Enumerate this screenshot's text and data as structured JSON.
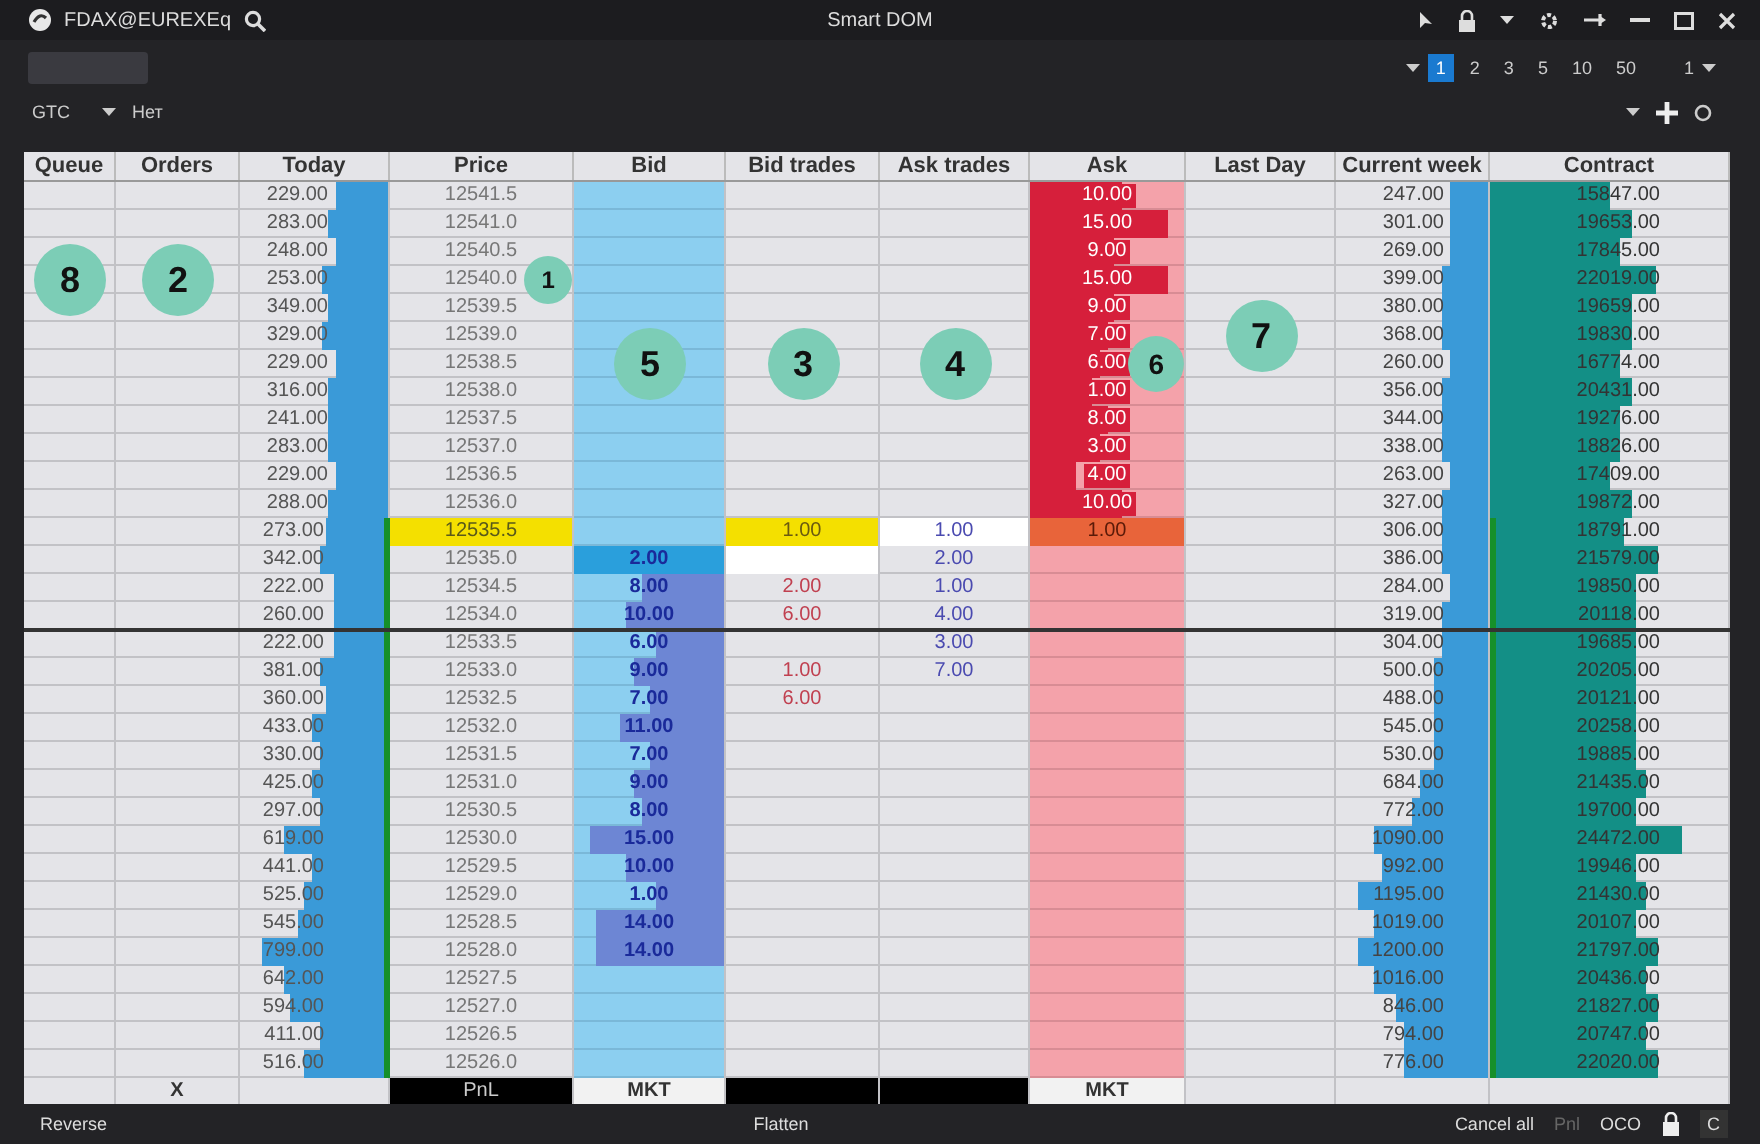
{
  "window": {
    "symbol": "FDAX@EUREXEq",
    "title": "Smart DOM"
  },
  "quantities": [
    {
      "label": "1",
      "selected": true
    },
    {
      "label": "2",
      "selected": false
    },
    {
      "label": "3",
      "selected": false
    },
    {
      "label": "5",
      "selected": false
    },
    {
      "label": "10",
      "selected": false
    },
    {
      "label": "50",
      "selected": false
    }
  ],
  "multiplier": "1",
  "order_bar": {
    "duration": "GTC",
    "option": "Нет"
  },
  "columns": [
    {
      "label": "Queue",
      "callout": "8"
    },
    {
      "label": "Orders",
      "callout": "2"
    },
    {
      "label": "Today"
    },
    {
      "label": "Price",
      "callout": "1"
    },
    {
      "label": "Bid",
      "callout": "5"
    },
    {
      "label": "Bid trades",
      "callout": "3"
    },
    {
      "label": "Ask trades",
      "callout": "4"
    },
    {
      "label": "Ask",
      "callout": "6"
    },
    {
      "label": "Last Day",
      "callout": "7"
    },
    {
      "label": "Current week"
    },
    {
      "label": "Contract"
    }
  ],
  "rows": [
    {
      "price": "12541.5",
      "today": {
        "value": "229.00",
        "level": 0.35
      },
      "ask": {
        "value": "10.00",
        "level": 0.6
      },
      "current_week": {
        "value": "247.00",
        "level": 0.25
      },
      "contract": {
        "value": "15847.00",
        "level": 0.5
      },
      "last_trade": false,
      "best_bid": false,
      "in_range": false
    },
    {
      "price": "12541.0",
      "today": {
        "value": "283.00",
        "level": 0.4
      },
      "ask": {
        "value": "15.00",
        "level": 0.9
      },
      "current_week": {
        "value": "301.00",
        "level": 0.25
      },
      "contract": {
        "value": "19653.00",
        "level": 0.6
      },
      "last_trade": false,
      "best_bid": false,
      "in_range": false
    },
    {
      "price": "12540.5",
      "today": {
        "value": "248.00",
        "level": 0.35
      },
      "ask": {
        "value": "9.00",
        "level": 0.55
      },
      "current_week": {
        "value": "269.00",
        "level": 0.25
      },
      "contract": {
        "value": "17845.00",
        "level": 0.55
      },
      "last_trade": false,
      "best_bid": false,
      "in_range": false
    },
    {
      "price": "12540.0",
      "today": {
        "value": "253.00",
        "level": 0.45
      },
      "ask": {
        "value": "15.00",
        "level": 0.9
      },
      "current_week": {
        "value": "399.00",
        "level": 0.3
      },
      "contract": {
        "value": "22019.00",
        "level": 0.7
      },
      "last_trade": false,
      "best_bid": false,
      "in_range": false
    },
    {
      "price": "12539.5",
      "today": {
        "value": "349.00",
        "level": 0.4
      },
      "ask": {
        "value": "9.00",
        "level": 0.55
      },
      "current_week": {
        "value": "380.00",
        "level": 0.3
      },
      "contract": {
        "value": "19659.00",
        "level": 0.6
      },
      "last_trade": false,
      "best_bid": false,
      "in_range": false
    },
    {
      "price": "12539.0",
      "today": {
        "value": "329.00",
        "level": 0.45
      },
      "ask": {
        "value": "7.00",
        "level": 0.5
      },
      "current_week": {
        "value": "368.00",
        "level": 0.3
      },
      "contract": {
        "value": "19830.00",
        "level": 0.6
      },
      "last_trade": false,
      "best_bid": false,
      "in_range": false
    },
    {
      "price": "12538.5",
      "today": {
        "value": "229.00",
        "level": 0.35
      },
      "ask": {
        "value": "6.00",
        "level": 0.45
      },
      "current_week": {
        "value": "260.00",
        "level": 0.25
      },
      "contract": {
        "value": "16774.00",
        "level": 0.55
      },
      "last_trade": false,
      "best_bid": false,
      "in_range": false
    },
    {
      "price": "12538.0",
      "today": {
        "value": "316.00",
        "level": 0.4
      },
      "ask": {
        "value": "1.00",
        "level": 0.4
      },
      "current_week": {
        "value": "356.00",
        "level": 0.3
      },
      "contract": {
        "value": "20431.00",
        "level": 0.6
      },
      "last_trade": false,
      "best_bid": false,
      "in_range": false
    },
    {
      "price": "12537.5",
      "today": {
        "value": "241.00",
        "level": 0.4
      },
      "ask": {
        "value": "8.00",
        "level": 0.5
      },
      "current_week": {
        "value": "344.00",
        "level": 0.3
      },
      "contract": {
        "value": "19276.00",
        "level": 0.55
      },
      "last_trade": false,
      "best_bid": false,
      "in_range": false
    },
    {
      "price": "12537.0",
      "today": {
        "value": "283.00",
        "level": 0.4
      },
      "ask": {
        "value": "3.00",
        "level": 0.45
      },
      "current_week": {
        "value": "338.00",
        "level": 0.3
      },
      "contract": {
        "value": "18826.00",
        "level": 0.55
      },
      "last_trade": false,
      "best_bid": false,
      "in_range": false
    },
    {
      "price": "12536.5",
      "today": {
        "value": "229.00",
        "level": 0.35
      },
      "ask": {
        "value": "4.00",
        "level": 0.3
      },
      "current_week": {
        "value": "263.00",
        "level": 0.25
      },
      "contract": {
        "value": "17409.00",
        "level": 0.5
      },
      "last_trade": false,
      "best_bid": false,
      "in_range": false
    },
    {
      "price": "12536.0",
      "today": {
        "value": "288.00",
        "level": 0.4
      },
      "ask": {
        "value": "10.00",
        "level": 0.6
      },
      "current_week": {
        "value": "327.00",
        "level": 0.3
      },
      "contract": {
        "value": "19872.00",
        "level": 0.6
      },
      "last_trade": false,
      "best_bid": false,
      "in_range": false
    },
    {
      "price": "12535.5",
      "today": {
        "value": "273.00",
        "level": 0.4
      },
      "bid_trades": "1.00",
      "ask_trades": "1.00",
      "ask": {
        "value": "1.00"
      },
      "current_week": {
        "value": "306.00",
        "level": 0.3
      },
      "contract": {
        "value": "18791.00",
        "level": 0.55
      },
      "last_trade": true,
      "best_bid": false,
      "in_range": true
    },
    {
      "price": "12535.0",
      "today": {
        "value": "342.00",
        "level": 0.45
      },
      "bid": {
        "value": "2.00"
      },
      "ask_trades": "2.00",
      "current_week": {
        "value": "386.00",
        "level": 0.3
      },
      "contract": {
        "value": "21579.00",
        "level": 0.7
      },
      "last_trade": false,
      "best_bid": true,
      "in_range": true
    },
    {
      "price": "12534.5",
      "today": {
        "value": "222.00",
        "level": 0.35
      },
      "bid": {
        "value": "8.00",
        "level": 0.55
      },
      "bid_trades": "2.00",
      "ask_trades": "1.00",
      "current_week": {
        "value": "284.00",
        "level": 0.25
      },
      "contract": {
        "value": "19850.00",
        "level": 0.6
      },
      "last_trade": false,
      "best_bid": false,
      "in_range": true
    },
    {
      "price": "12534.0",
      "today": {
        "value": "260.00",
        "level": 0.35
      },
      "bid": {
        "value": "10.00",
        "level": 0.65
      },
      "bid_trades": "6.00",
      "ask_trades": "4.00",
      "current_week": {
        "value": "319.00",
        "level": 0.3
      },
      "contract": {
        "value": "20118.00",
        "level": 0.6
      },
      "last_trade": false,
      "best_bid": false,
      "in_range": true
    },
    {
      "price": "12533.5",
      "today": {
        "value": "222.00",
        "level": 0.35
      },
      "bid": {
        "value": "6.00",
        "level": 0.45
      },
      "ask_trades": "3.00",
      "current_week": {
        "value": "304.00",
        "level": 0.3
      },
      "contract": {
        "value": "19685.00",
        "level": 0.6
      },
      "last_trade": false,
      "best_bid": false,
      "in_range": true
    },
    {
      "price": "12533.0",
      "today": {
        "value": "381.00",
        "level": 0.45
      },
      "bid": {
        "value": "9.00",
        "level": 0.6
      },
      "bid_trades": "1.00",
      "ask_trades": "7.00",
      "current_week": {
        "value": "500.00",
        "level": 0.35
      },
      "contract": {
        "value": "20205.00",
        "level": 0.6
      },
      "last_trade": false,
      "best_bid": false,
      "in_range": true
    },
    {
      "price": "12532.5",
      "today": {
        "value": "360.00",
        "level": 0.4
      },
      "bid": {
        "value": "7.00",
        "level": 0.5
      },
      "bid_trades": "6.00",
      "current_week": {
        "value": "488.00",
        "level": 0.35
      },
      "contract": {
        "value": "20121.00",
        "level": 0.6
      },
      "last_trade": false,
      "best_bid": false,
      "in_range": true
    },
    {
      "price": "12532.0",
      "today": {
        "value": "433.00",
        "level": 0.5
      },
      "bid": {
        "value": "11.00",
        "level": 0.7
      },
      "current_week": {
        "value": "545.00",
        "level": 0.35
      },
      "contract": {
        "value": "20258.00",
        "level": 0.6
      },
      "last_trade": false,
      "best_bid": false,
      "in_range": true
    },
    {
      "price": "12531.5",
      "today": {
        "value": "330.00",
        "level": 0.45
      },
      "bid": {
        "value": "7.00",
        "level": 0.5
      },
      "current_week": {
        "value": "530.00",
        "level": 0.35
      },
      "contract": {
        "value": "19885.00",
        "level": 0.6
      },
      "last_trade": false,
      "best_bid": false,
      "in_range": true
    },
    {
      "price": "12531.0",
      "today": {
        "value": "425.00",
        "level": 0.5
      },
      "bid": {
        "value": "9.00",
        "level": 0.6
      },
      "current_week": {
        "value": "684.00",
        "level": 0.45
      },
      "contract": {
        "value": "21435.00",
        "level": 0.65
      },
      "last_trade": false,
      "best_bid": false,
      "in_range": true
    },
    {
      "price": "12530.5",
      "today": {
        "value": "297.00",
        "level": 0.45
      },
      "bid": {
        "value": "8.00",
        "level": 0.55
      },
      "current_week": {
        "value": "772.00",
        "level": 0.5
      },
      "contract": {
        "value": "19700.00",
        "level": 0.6
      },
      "last_trade": false,
      "best_bid": false,
      "in_range": true
    },
    {
      "price": "12530.0",
      "today": {
        "value": "619.00",
        "level": 0.7
      },
      "bid": {
        "value": "15.00",
        "level": 0.9
      },
      "current_week": {
        "value": "1090.00",
        "level": 0.75
      },
      "contract": {
        "value": "24472.00",
        "level": 0.8
      },
      "last_trade": false,
      "best_bid": false,
      "in_range": true
    },
    {
      "price": "12529.5",
      "today": {
        "value": "441.00",
        "level": 0.5
      },
      "bid": {
        "value": "10.00",
        "level": 0.65
      },
      "current_week": {
        "value": "992.00",
        "level": 0.7
      },
      "contract": {
        "value": "19946.00",
        "level": 0.6
      },
      "last_trade": false,
      "best_bid": false,
      "in_range": true
    },
    {
      "price": "12529.0",
      "today": {
        "value": "525.00",
        "level": 0.55
      },
      "bid": {
        "value": "1.00",
        "level": 0.45
      },
      "current_week": {
        "value": "1195.00",
        "level": 0.85
      },
      "contract": {
        "value": "21430.00",
        "level": 0.65
      },
      "last_trade": false,
      "best_bid": false,
      "in_range": true
    },
    {
      "price": "12528.5",
      "today": {
        "value": "545.00",
        "level": 0.6
      },
      "bid": {
        "value": "14.00",
        "level": 0.85
      },
      "current_week": {
        "value": "1019.00",
        "level": 0.75
      },
      "contract": {
        "value": "20107.00",
        "level": 0.6
      },
      "last_trade": false,
      "best_bid": false,
      "in_range": true
    },
    {
      "price": "12528.0",
      "today": {
        "value": "799.00",
        "level": 0.85
      },
      "bid": {
        "value": "14.00",
        "level": 0.85
      },
      "current_week": {
        "value": "1200.00",
        "level": 0.85
      },
      "contract": {
        "value": "21797.00",
        "level": 0.7
      },
      "last_trade": false,
      "best_bid": false,
      "in_range": true
    },
    {
      "price": "12527.5",
      "today": {
        "value": "642.00",
        "level": 0.7
      },
      "current_week": {
        "value": "1016.00",
        "level": 0.75
      },
      "contract": {
        "value": "20436.00",
        "level": 0.65
      },
      "last_trade": false,
      "best_bid": false,
      "in_range": true
    },
    {
      "price": "12527.0",
      "today": {
        "value": "594.00",
        "level": 0.65
      },
      "current_week": {
        "value": "846.00",
        "level": 0.6
      },
      "contract": {
        "value": "21827.00",
        "level": 0.7
      },
      "last_trade": false,
      "best_bid": false,
      "in_range": true
    },
    {
      "price": "12526.5",
      "today": {
        "value": "411.00",
        "level": 0.45
      },
      "current_week": {
        "value": "794.00",
        "level": 0.55
      },
      "contract": {
        "value": "20747.00",
        "level": 0.65
      },
      "last_trade": false,
      "best_bid": false,
      "in_range": true
    },
    {
      "price": "12526.0",
      "today": {
        "value": "516.00",
        "level": 0.55
      },
      "current_week": {
        "value": "776.00",
        "level": 0.55
      },
      "contract": {
        "value": "22020.00",
        "level": 0.7
      },
      "last_trade": false,
      "best_bid": false,
      "in_range": true
    }
  ],
  "footer": [
    {
      "kind": "blank"
    },
    {
      "kind": "blank",
      "text": "X"
    },
    {
      "kind": "blank"
    },
    {
      "kind": "dark",
      "text": "PnL"
    },
    {
      "kind": "light",
      "text": "MKT"
    },
    {
      "kind": "dark"
    },
    {
      "kind": "dark"
    },
    {
      "kind": "light",
      "text": "MKT"
    },
    {
      "kind": "blank"
    },
    {
      "kind": "blank"
    },
    {
      "kind": "blank"
    }
  ],
  "bottom_bar": {
    "left": "Reverse",
    "center": "Flatten",
    "right": [
      {
        "label": "Cancel all",
        "disabled": false
      },
      {
        "label": "Pnl",
        "disabled": true
      },
      {
        "label": "OCO",
        "disabled": false
      }
    ],
    "last": "C"
  }
}
